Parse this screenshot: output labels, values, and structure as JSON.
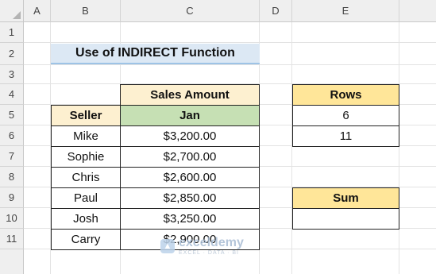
{
  "columns": [
    "A",
    "B",
    "C",
    "D",
    "E"
  ],
  "rows": [
    "1",
    "2",
    "3",
    "4",
    "5",
    "6",
    "7",
    "8",
    "9",
    "10",
    "11"
  ],
  "title": "Use of INDIRECT Function",
  "table": {
    "group_header": "Sales Amount",
    "seller_header": "Seller",
    "month_header": "Jan",
    "sellers": [
      "Mike",
      "Sophie",
      "Chris",
      "Paul",
      "Josh",
      "Carry"
    ],
    "amounts": [
      "$3,200.00",
      "$2,700.00",
      "$2,600.00",
      "$2,850.00",
      "$3,250.00",
      "$2,900.00"
    ]
  },
  "rows_box": {
    "header": "Rows",
    "values": [
      "6",
      "11"
    ]
  },
  "sum_box": {
    "header": "Sum",
    "value": ""
  },
  "watermark": {
    "name": "exceldemy",
    "tagline": "EXCEL · DATA · BI"
  },
  "colors": {
    "title_fill": "#dce8f4",
    "header_tan": "#fdf0d0",
    "header_green": "#c6e0b4",
    "header_gold": "#ffe699"
  }
}
